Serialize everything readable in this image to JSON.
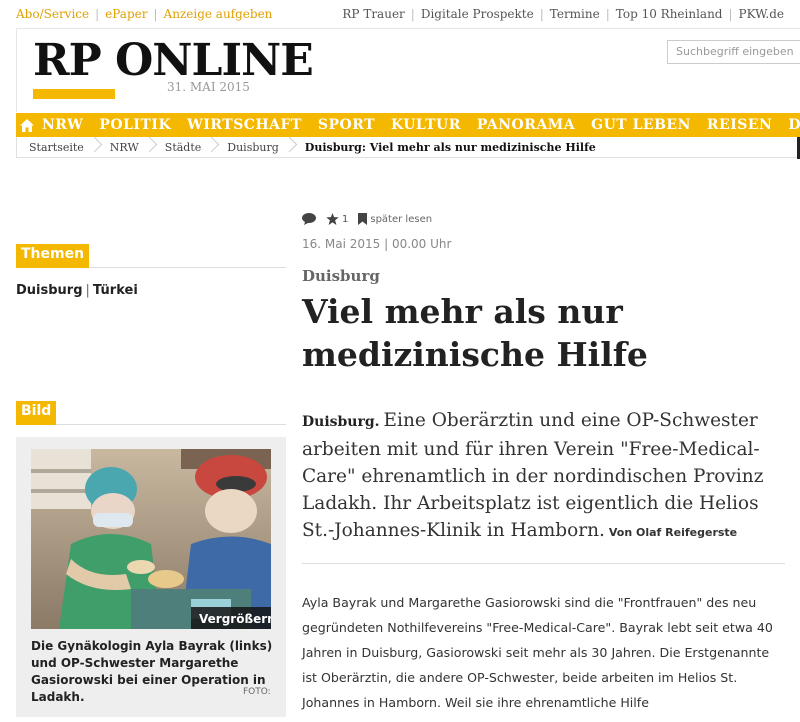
{
  "topbar": {
    "left_links": [
      "Abo/Service",
      "ePaper",
      "Anzeige aufgeben"
    ],
    "right_links": [
      "RP Trauer",
      "Digitale Prospekte",
      "Termine",
      "Top 10 Rheinland",
      "PKW.de"
    ]
  },
  "header": {
    "logo_text": "RP ONLINE",
    "date": "31. MAI 2015",
    "search_placeholder": "Suchbegriff eingeben"
  },
  "nav": {
    "home_icon": "home-icon",
    "items": [
      "NRW",
      "POLITIK",
      "WIRTSCHAFT",
      "SPORT",
      "KULTUR",
      "PANORAMA",
      "GUT LEBEN",
      "REISEN",
      "DIGITA"
    ]
  },
  "breadcrumb": [
    "Startseite",
    "NRW",
    "Städte",
    "Duisburg",
    "Duisburg: Viel mehr als nur medizinische Hilfe"
  ],
  "sidebar": {
    "themen": {
      "heading": "Themen",
      "links": [
        "Duisburg",
        "Türkei"
      ]
    },
    "bild": {
      "heading": "Bild",
      "zoom_label": "Vergrößern",
      "caption": "Die Gynäkologin Ayla Bayrak (links) und OP-Schwester Margarethe Gasiorowski bei einer Operation in Ladakh.",
      "foto_label": "FOTO:"
    }
  },
  "article": {
    "meta": {
      "favorites_count": "1",
      "read_later": "später lesen"
    },
    "date": "16. Mai 2015 | 00.00 Uhr",
    "kicker": "Duisburg",
    "headline": "Viel mehr als nur medizinische Hilfe",
    "lead_location": "Duisburg.",
    "lead_text": "Eine Oberärztin und eine OP-Schwester arbeiten mit und für ihren Verein \"Free-Medical-Care\" ehrenamtlich in der nordindischen Provinz Ladakh. Ihr Arbeitsplatz ist eigentlich die Helios St.-Johannes-Klinik in Hamborn.",
    "author": "Von Olaf Reifegerste",
    "body": "Ayla Bayrak und Margarethe Gasiorowski sind die \"Frontfrauen\" des neu gegründeten Nothilfevereins \"Free-Medical-Care\". Bayrak lebt seit etwa 40 Jahren in Duisburg, Gasiorowski seit mehr als 30 Jahren. Die Erstgenannte ist Oberärztin, die andere OP-Schwester, beide arbeiten im Helios St. Johannes in Hamborn. Weil sie ihre ehrenamtliche Hilfe"
  },
  "colors": {
    "accent": "#f5b800",
    "nav_text": "#ffffff"
  }
}
